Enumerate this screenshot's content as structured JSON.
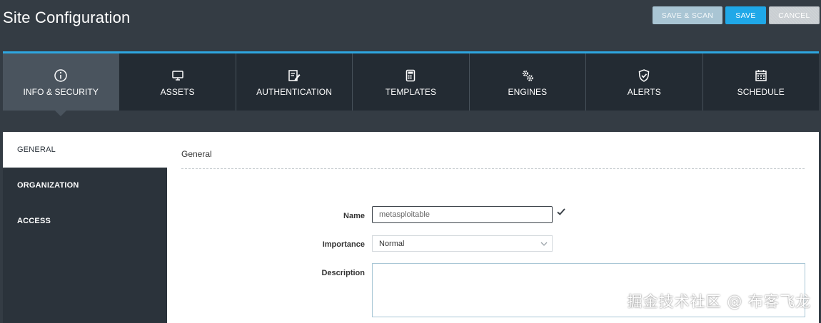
{
  "header": {
    "title": "Site Configuration",
    "buttons": {
      "save_scan": "SAVE & SCAN",
      "save": "SAVE",
      "cancel": "CANCEL"
    }
  },
  "tabs": [
    {
      "label": "INFO & SECURITY",
      "icon": "info-icon",
      "active": true
    },
    {
      "label": "ASSETS",
      "icon": "monitor-icon",
      "active": false
    },
    {
      "label": "AUTHENTICATION",
      "icon": "edit-document-icon",
      "active": false
    },
    {
      "label": "TEMPLATES",
      "icon": "calculator-icon",
      "active": false
    },
    {
      "label": "ENGINES",
      "icon": "gears-icon",
      "active": false
    },
    {
      "label": "ALERTS",
      "icon": "shield-check-icon",
      "active": false
    },
    {
      "label": "SCHEDULE",
      "icon": "calendar-icon",
      "active": false
    }
  ],
  "sidebar": {
    "items": [
      {
        "label": "GENERAL",
        "active": true
      },
      {
        "label": "ORGANIZATION",
        "active": false
      },
      {
        "label": "ACCESS",
        "active": false
      }
    ]
  },
  "main": {
    "section_title": "General",
    "fields": {
      "name": {
        "label": "Name",
        "value": "metasploitable"
      },
      "importance": {
        "label": "Importance",
        "value": "Normal"
      },
      "description": {
        "label": "Description",
        "value": ""
      }
    }
  },
  "watermark": "掘金技术社区 @ 布客飞龙",
  "colors": {
    "accent": "#2ea6e0",
    "save_button": "#1fa8e8",
    "header_bg": "#343c44",
    "tab_bg": "#232b33",
    "tab_active_bg": "#4a545e"
  }
}
